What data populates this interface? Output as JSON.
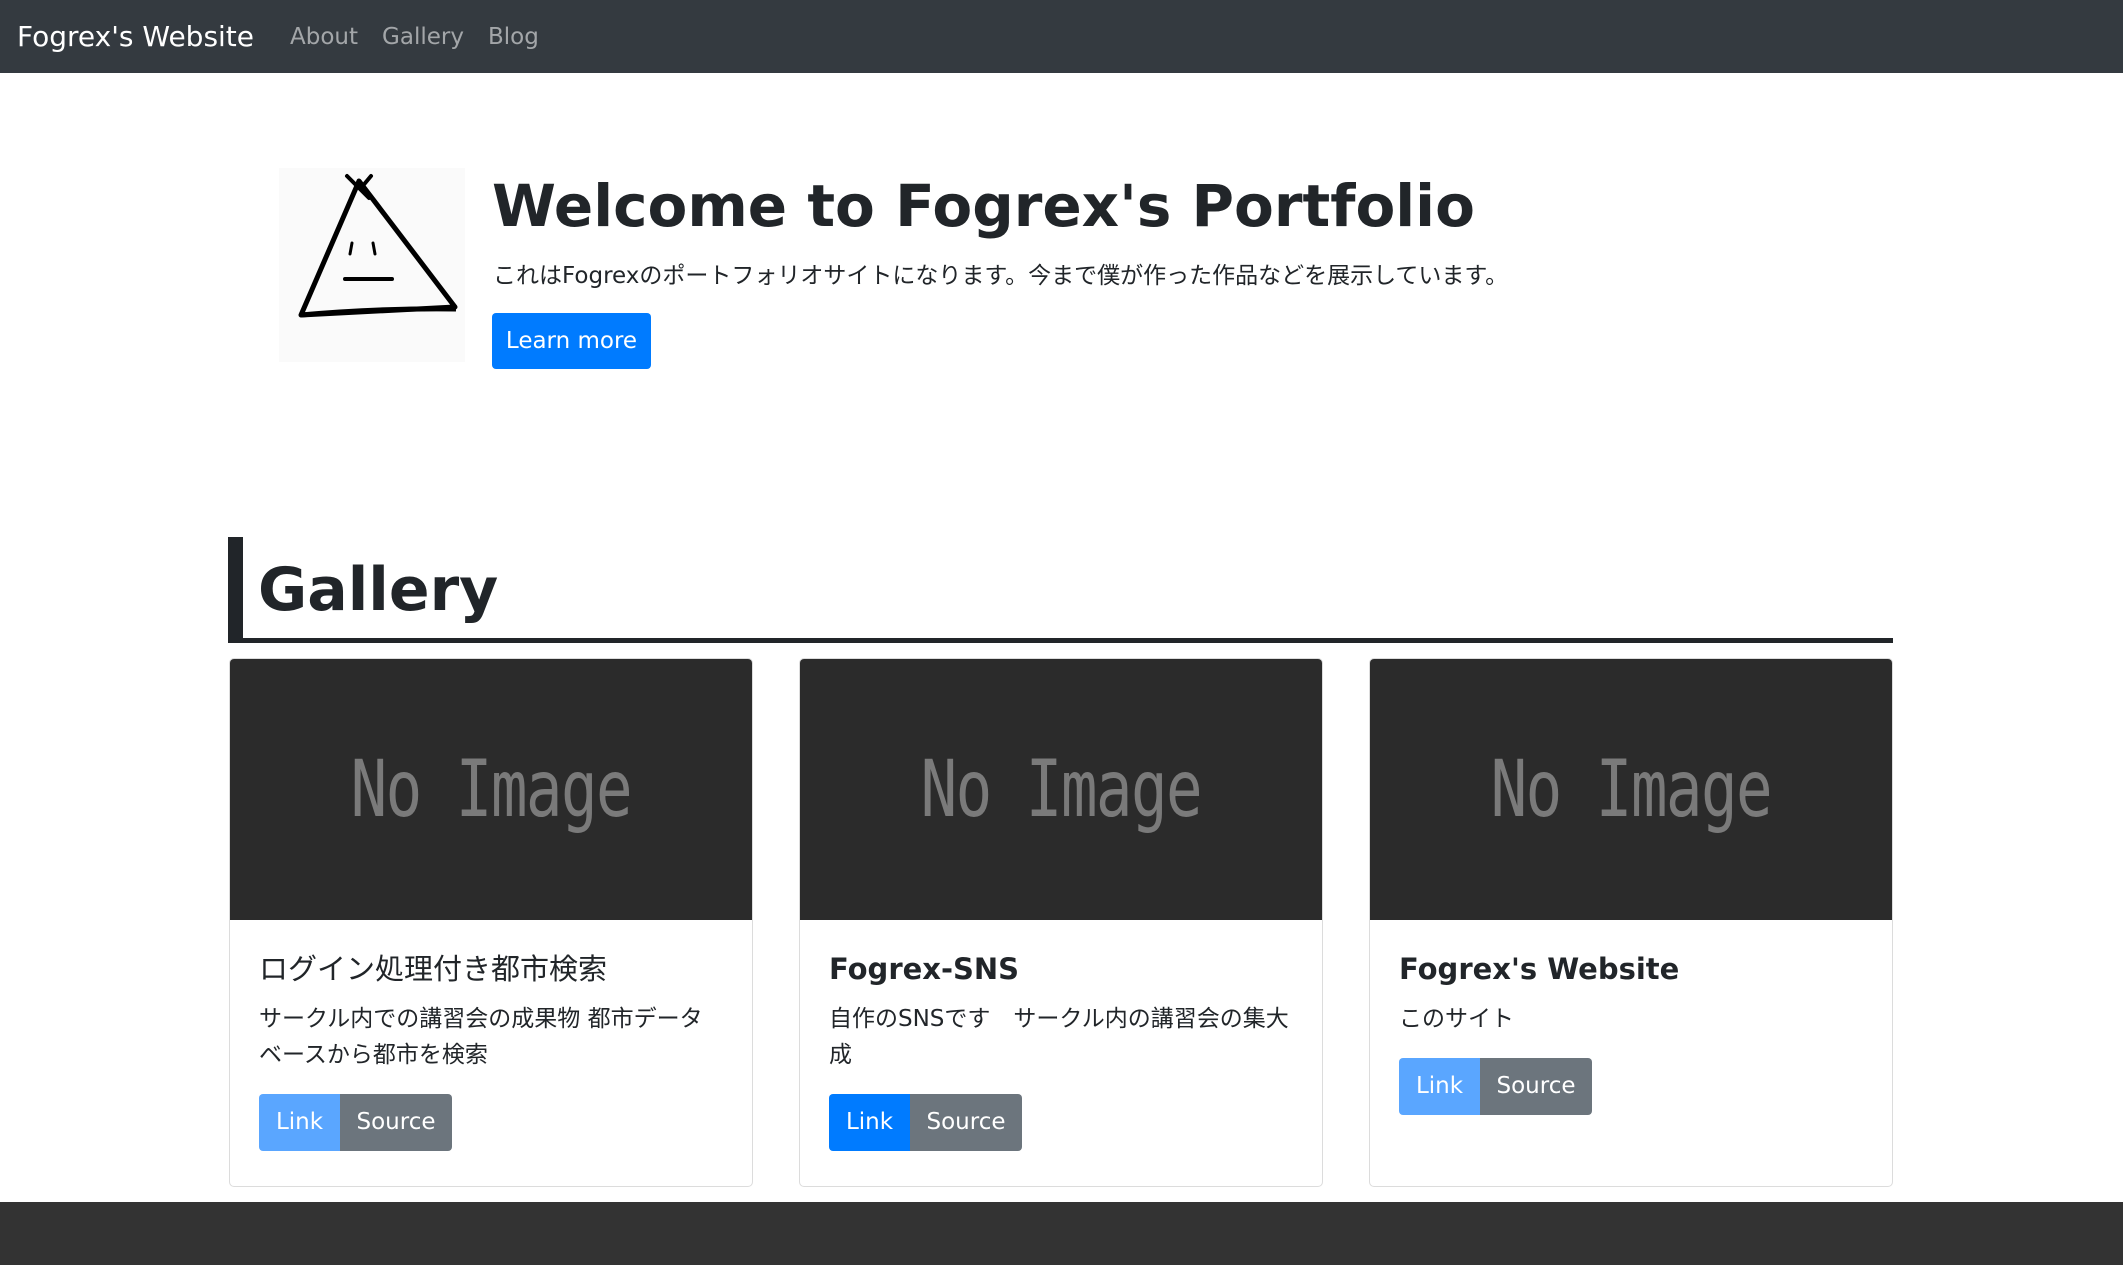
{
  "nav": {
    "brand": "Fogrex's Website",
    "links": [
      "About",
      "Gallery",
      "Blog"
    ]
  },
  "hero": {
    "logo_icon": "triangle-face-logo",
    "title": "Welcome to Fogrex's Portfolio",
    "text": "これはFogrexのポートフォリオサイトになります。今まで僕が作った作品などを展示しています。",
    "button_label": "Learn more"
  },
  "gallery": {
    "heading": "Gallery",
    "cards": [
      {
        "image_text": "No Image",
        "title": "ログイン処理付き都市検索",
        "text": "サークル内での講習会の成果物 都市データベースから都市を検索",
        "link_label": "Link",
        "source_label": "Source"
      },
      {
        "image_text": "No Image",
        "title": "Fogrex-SNS",
        "text": "自作のSNSです　サークル内の講習会の集大成",
        "link_label": "Link",
        "source_label": "Source"
      },
      {
        "image_text": "No Image",
        "title": "Fogrex's Website",
        "text": "このサイト",
        "link_label": "Link",
        "source_label": "Source"
      }
    ]
  },
  "colors": {
    "navbar": "#343a40",
    "primary": "#007bff",
    "primary_faded": "#5aa6ff",
    "secondary": "#6c757d",
    "footer": "#333333"
  }
}
